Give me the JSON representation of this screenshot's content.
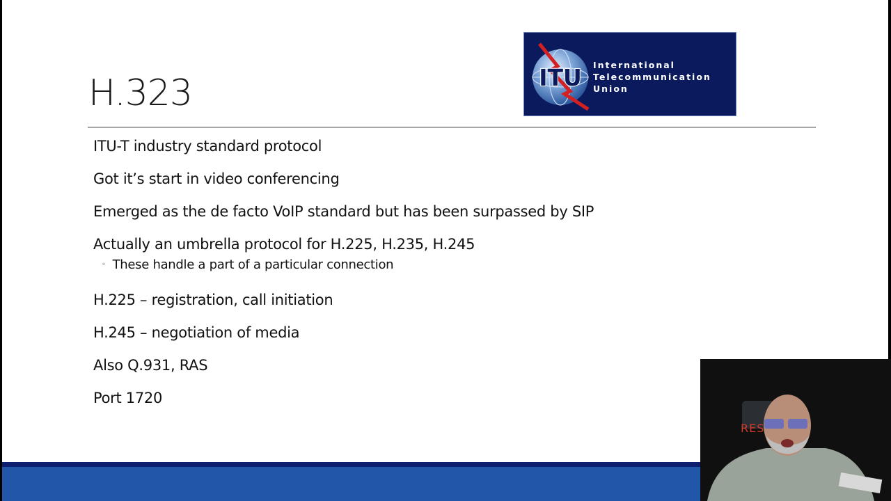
{
  "slide": {
    "title": "H.323",
    "logo": {
      "monogram": "ITU",
      "name_lines": [
        "International",
        "Telecommunication",
        "Union"
      ],
      "background_color": "#0a1a5c"
    },
    "bullets": [
      {
        "text": "ITU-T industry standard protocol"
      },
      {
        "text": "Got it’s start in video conferencing"
      },
      {
        "text": "Emerged as the de facto VoIP standard but has been surpassed by SIP"
      },
      {
        "text": "Actually an umbrella protocol for H.225, H.235, H.245",
        "sub": [
          {
            "marker": "◦",
            "text": "These handle a part of a particular connection"
          }
        ]
      },
      {
        "text": "H.225 – registration, call initiation"
      },
      {
        "text": "H.245 – negotiation of media"
      },
      {
        "text": "Also Q.931, RAS"
      },
      {
        "text": "Port 1720"
      }
    ],
    "footer_colors": {
      "dark": "#0f1e6e",
      "blue": "#2156a8"
    }
  },
  "webcam": {
    "background_sign_text": "RES"
  }
}
